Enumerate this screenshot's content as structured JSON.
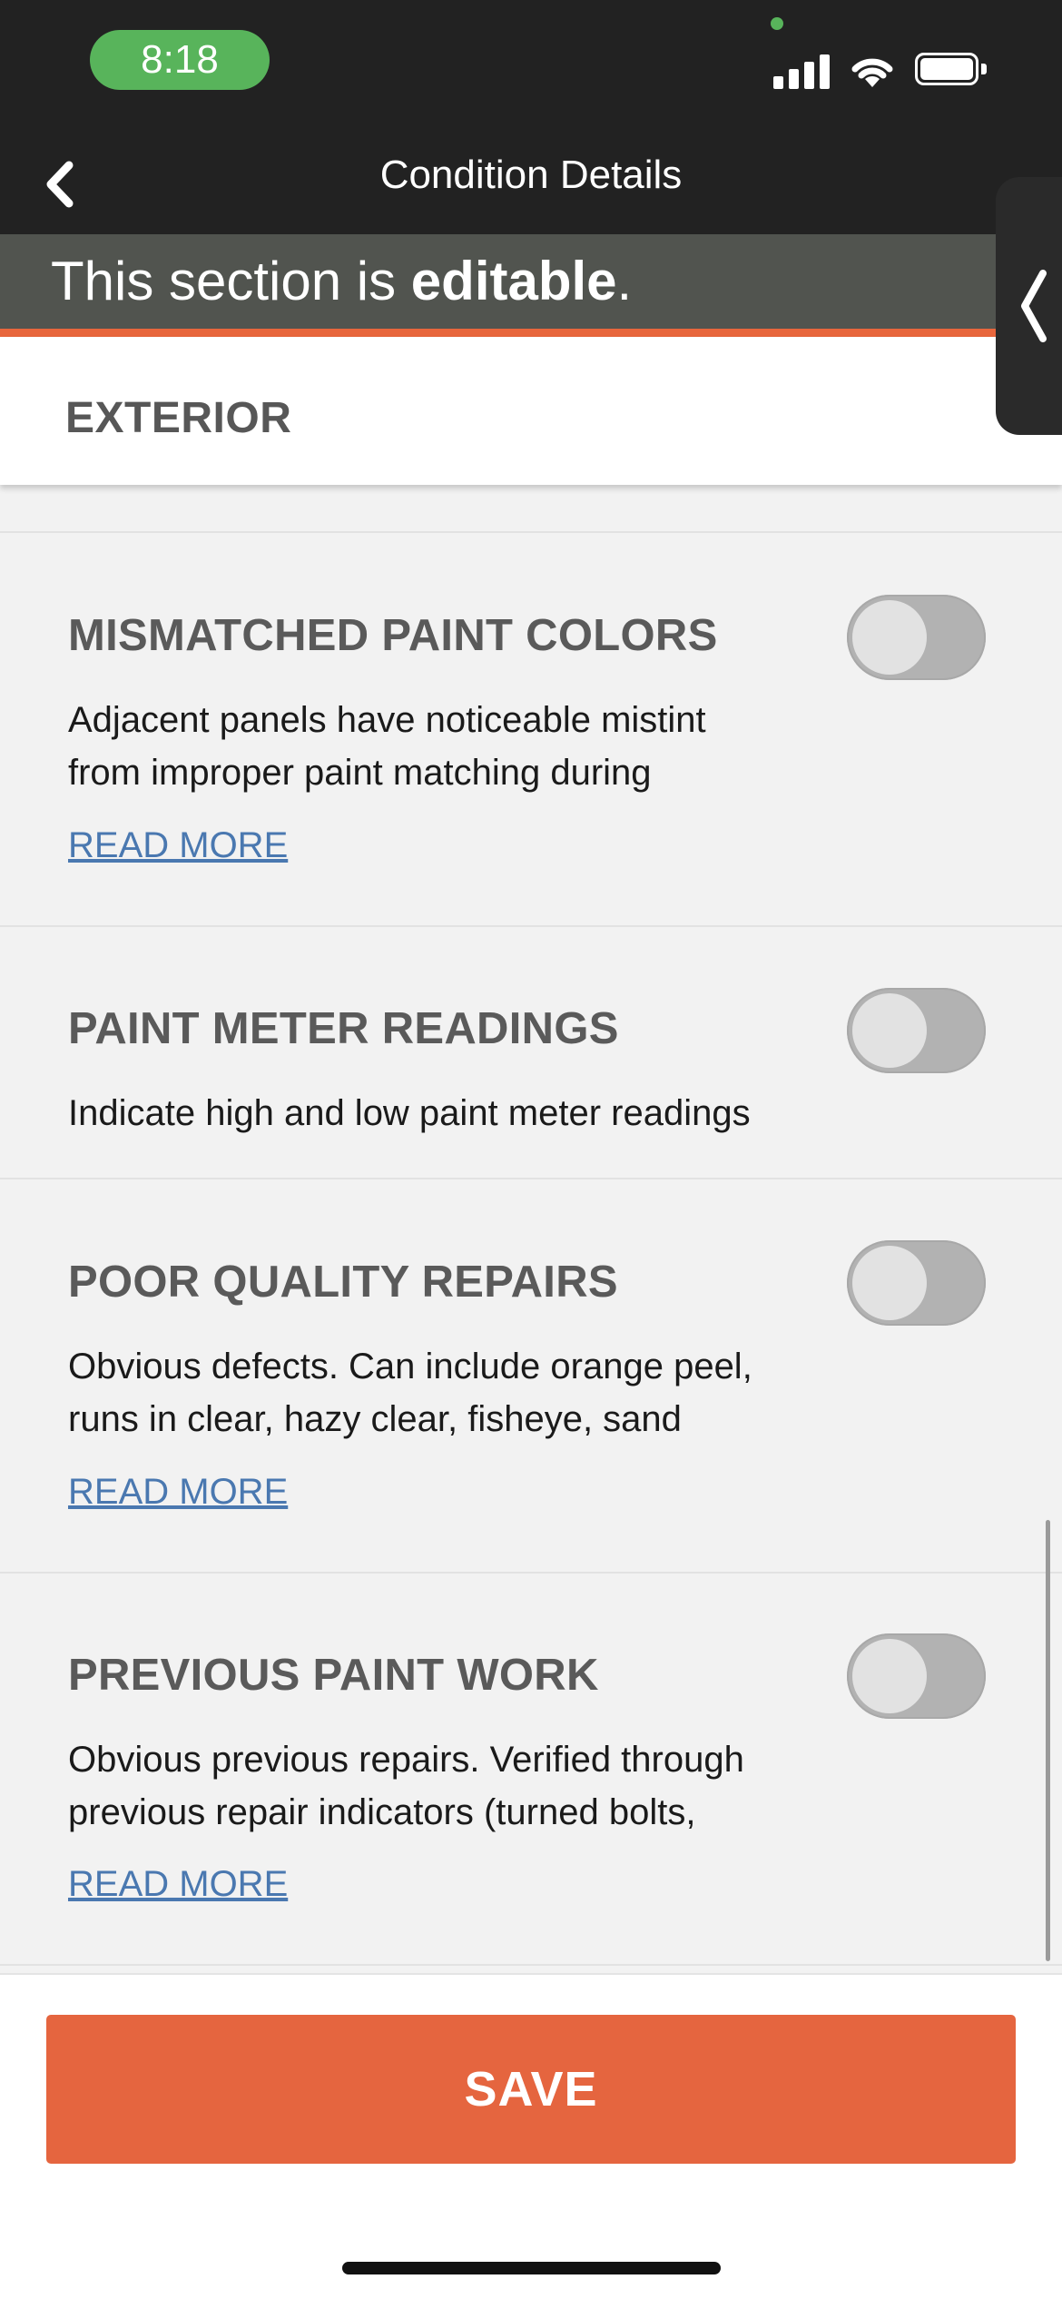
{
  "status_bar": {
    "time": "8:18"
  },
  "nav": {
    "title": "Condition Details"
  },
  "banner": {
    "prefix": "This section is ",
    "emphasis": "editable",
    "suffix": "."
  },
  "section": {
    "title": "EXTERIOR"
  },
  "conditions": [
    {
      "title": "MISMATCHED PAINT COLORS",
      "description_line1": "Adjacent panels have noticeable mistint",
      "description_line2": "from improper paint matching during",
      "read_more": "READ MORE",
      "enabled": false
    },
    {
      "title": "PAINT METER READINGS",
      "description_line1": "Indicate high and low paint meter readings",
      "enabled": false
    },
    {
      "title": "POOR QUALITY REPAIRS",
      "description_line1": "Obvious defects. Can include orange peel,",
      "description_line2": "runs in clear, hazy clear, fisheye, sand",
      "read_more": "READ MORE",
      "enabled": false
    },
    {
      "title": "PREVIOUS PAINT WORK",
      "description_line1": "Obvious previous repairs. Verified through",
      "description_line2": "previous repair indicators (turned bolts,",
      "read_more": "READ MORE",
      "enabled": false
    }
  ],
  "footer": {
    "save_label": "SAVE"
  },
  "colors": {
    "accent": "#e5653f",
    "banner": "#51544f",
    "link": "#4a78b0",
    "header_bg": "#222222",
    "time_pill": "#58b45b"
  },
  "icons": {
    "back": "chevron-left-icon",
    "side_tab": "chevron-left-icon",
    "signal": "cellular-signal-icon",
    "wifi": "wifi-icon",
    "battery": "battery-icon"
  }
}
